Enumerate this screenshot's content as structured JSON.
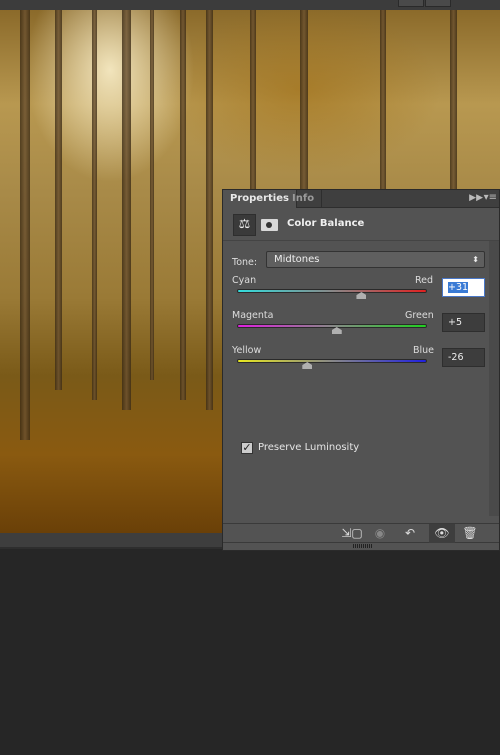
{
  "panel": {
    "tabs": [
      {
        "label": "Properties",
        "active": true
      },
      {
        "label": "Info",
        "active": false
      }
    ],
    "adjustment_title": "Color Balance",
    "icons": {
      "adjustment": "scales-icon",
      "mask": "mask-icon",
      "collapse": "double-chevron-right-icon",
      "menu": "panel-menu-icon"
    },
    "tone": {
      "label": "Tone:",
      "value": "Midtones"
    },
    "sliders": [
      {
        "left": "Cyan",
        "right": "Red",
        "value": "+31",
        "level": 31,
        "min": -100,
        "max": 100,
        "left_color": "#33dddd",
        "right_color": "#e02020"
      },
      {
        "left": "Magenta",
        "right": "Green",
        "value": "+5",
        "level": 5,
        "min": -100,
        "max": 100,
        "left_color": "#e020e0",
        "right_color": "#20d020"
      },
      {
        "left": "Yellow",
        "right": "Blue",
        "value": "-26",
        "level": -26,
        "min": -100,
        "max": 100,
        "left_color": "#e8e820",
        "right_color": "#2020e0"
      }
    ],
    "preserve_luminosity": {
      "label": "Preserve Luminosity",
      "checked": true
    },
    "footer_buttons": [
      "clip-to-layer-icon",
      "view-previous-state-icon",
      "reset-icon",
      "visibility-eye-icon",
      "trash-icon"
    ]
  }
}
